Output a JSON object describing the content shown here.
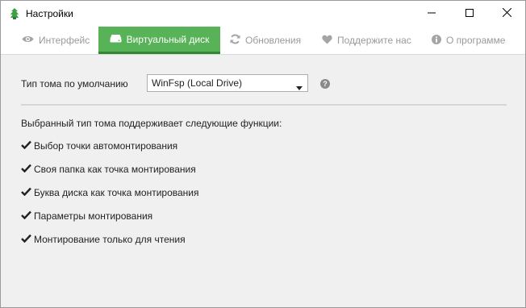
{
  "window": {
    "title": "Настройки",
    "icons": [
      "app-logo-icon",
      "minimize-icon",
      "maximize-icon",
      "close-icon"
    ]
  },
  "tabs": [
    {
      "label": "Интерфейс",
      "icon": "eye-icon",
      "active": false
    },
    {
      "label": "Виртуальный диск",
      "icon": "drive-icon",
      "active": true
    },
    {
      "label": "Обновления",
      "icon": "refresh-icon",
      "active": false
    },
    {
      "label": "Поддержите нас",
      "icon": "heart-icon",
      "active": false
    },
    {
      "label": "О программе",
      "icon": "info-icon",
      "active": false
    }
  ],
  "settings": {
    "volume_type_label": "Тип тома по умолчанию",
    "volume_type_value": "WinFsp (Local Drive)",
    "help_glyph": "?",
    "features_heading": "Выбранный тип тома поддерживает следующие функции:",
    "features": [
      "Выбор точки автомонтирования",
      "Своя папка как точка монтирования",
      "Буква диска как точка монтирования",
      "Параметры монтирования",
      "Монтирование только для чтения"
    ]
  },
  "colors": {
    "accent": "#58b358",
    "accent_dark": "#2f8a2f",
    "tab_inactive": "#9a9a9a",
    "background": "#f0f0f0"
  }
}
